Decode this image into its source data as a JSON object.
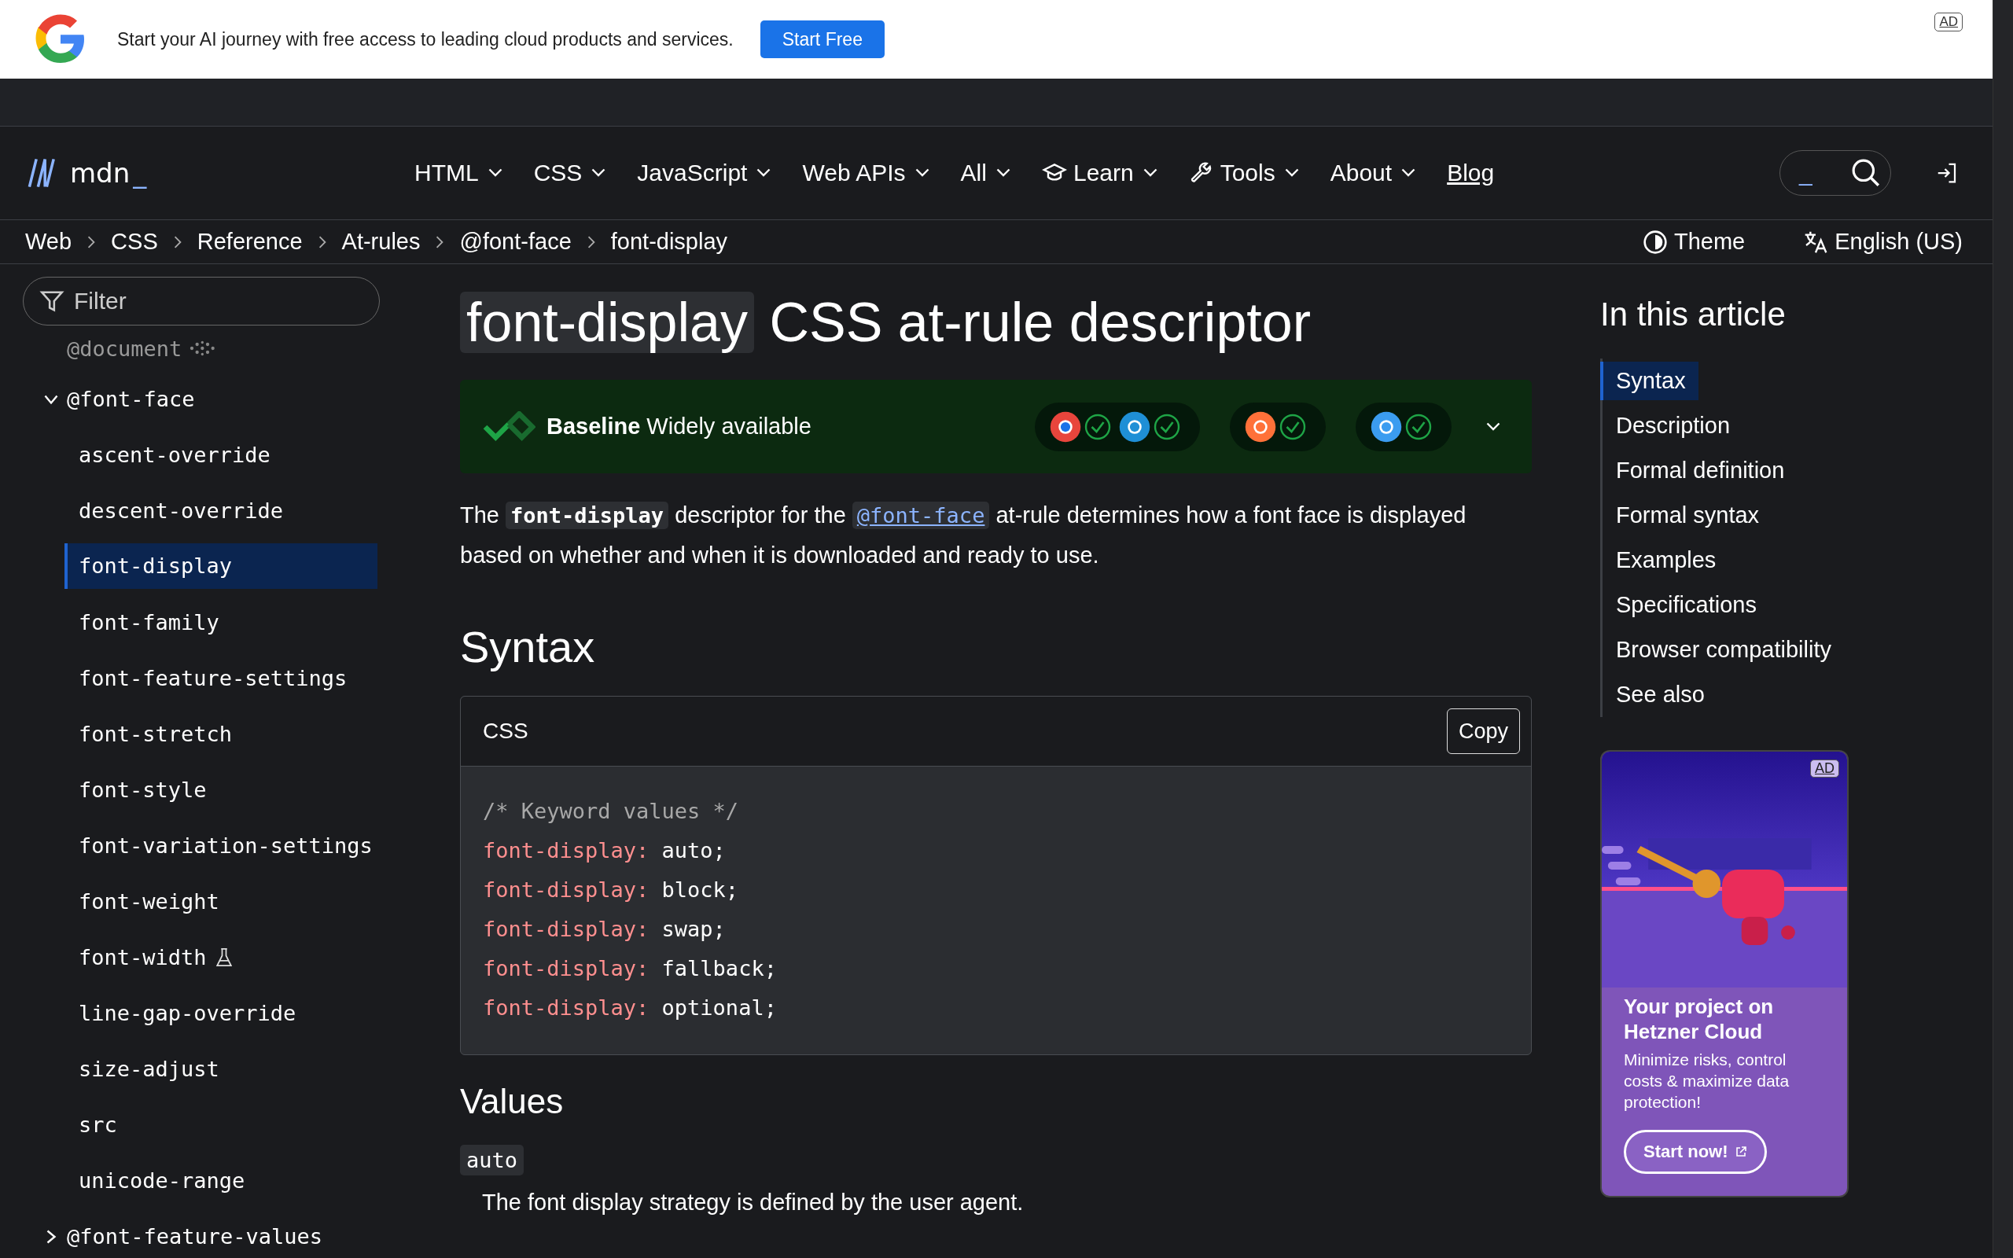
{
  "ad_banner": {
    "text": "Start your AI journey with free access to leading cloud products and services.",
    "button": "Start Free",
    "badge": "AD"
  },
  "nav": {
    "logo_text": "mdn",
    "logo_cursor": "_",
    "items": [
      {
        "label": "HTML",
        "kind": "menu"
      },
      {
        "label": "CSS",
        "kind": "menu"
      },
      {
        "label": "JavaScript",
        "kind": "menu"
      },
      {
        "label": "Web APIs",
        "kind": "menu"
      },
      {
        "label": "All",
        "kind": "menu"
      },
      {
        "label": "Learn",
        "kind": "menu"
      },
      {
        "label": "Tools",
        "kind": "menu"
      },
      {
        "label": "About",
        "kind": "menu"
      },
      {
        "label": "Blog",
        "kind": "link"
      }
    ],
    "search": {
      "value": "_"
    }
  },
  "breadcrumbs": [
    "Web",
    "CSS",
    "Reference",
    "At-rules",
    "@font-face",
    "font-display"
  ],
  "theme_button": "Theme",
  "language_button": "English (US)",
  "sidebar": {
    "filter": {
      "placeholder": "Filter"
    },
    "items": [
      {
        "label": "@document",
        "kind": "deprecated"
      },
      {
        "label": "@font-face",
        "kind": "group",
        "expanded": true,
        "children": [
          {
            "label": "ascent-override",
            "kind": "page",
            "selected": false
          },
          {
            "label": "descent-override",
            "kind": "page",
            "selected": false
          },
          {
            "label": "font-display",
            "kind": "page",
            "selected": true
          },
          {
            "label": "font-family",
            "kind": "page",
            "selected": false
          },
          {
            "label": "font-feature-settings",
            "kind": "page",
            "selected": false
          },
          {
            "label": "font-stretch",
            "kind": "page",
            "selected": false
          },
          {
            "label": "font-style",
            "kind": "page",
            "selected": false
          },
          {
            "label": "font-variation-settings",
            "kind": "page",
            "selected": false
          },
          {
            "label": "font-weight",
            "kind": "page",
            "selected": false
          },
          {
            "label": "font-width",
            "kind": "experimental",
            "selected": false
          },
          {
            "label": "line-gap-override",
            "kind": "page",
            "selected": false
          },
          {
            "label": "size-adjust",
            "kind": "page",
            "selected": false
          },
          {
            "label": "src",
            "kind": "page",
            "selected": false
          },
          {
            "label": "unicode-range",
            "kind": "page",
            "selected": false
          }
        ]
      },
      {
        "label": "@font-feature-values",
        "kind": "group",
        "expanded": false
      }
    ]
  },
  "article": {
    "title_code": "font-display",
    "title_rest": "CSS at-rule descriptor",
    "baseline": {
      "label": "Baseline",
      "status": "Widely available",
      "support_groups": [
        {
          "browsers": [
            {
              "supported": true
            },
            {
              "supported": true
            }
          ]
        },
        {
          "browsers": [
            {
              "supported": true
            }
          ]
        },
        {
          "browsers": [
            {
              "supported": true
            }
          ]
        }
      ]
    },
    "intro": [
      {
        "kind": "text",
        "text": "The "
      },
      {
        "kind": "code",
        "text": "font-display"
      },
      {
        "kind": "text",
        "text": " descriptor for the "
      },
      {
        "kind": "link",
        "text": "@font-face"
      },
      {
        "kind": "text",
        "text": " at-rule determines how a font face is displayed based on whether and when it is downloaded and ready to use."
      }
    ],
    "syntax_heading": "Syntax",
    "code_block": {
      "language": "CSS",
      "copy_button": "Copy",
      "lines": [
        {
          "kind": "comment",
          "text": "/* Keyword values */"
        },
        {
          "kind": "declaration",
          "property": "font-display:",
          "value": "auto;"
        },
        {
          "kind": "declaration",
          "property": "font-display:",
          "value": "block;"
        },
        {
          "kind": "declaration",
          "property": "font-display:",
          "value": "swap;"
        },
        {
          "kind": "declaration",
          "property": "font-display:",
          "value": "fallback;"
        },
        {
          "kind": "declaration",
          "property": "font-display:",
          "value": "optional;"
        }
      ]
    },
    "values_heading": "Values",
    "values": [
      {
        "term": "auto",
        "description": "The font display strategy is defined by the user agent."
      }
    ]
  },
  "toc": {
    "heading": "In this article",
    "items": [
      {
        "label": "Syntax",
        "selected": true
      },
      {
        "label": "Description",
        "selected": false
      },
      {
        "label": "Formal definition",
        "selected": false
      },
      {
        "label": "Formal syntax",
        "selected": false
      },
      {
        "label": "Examples",
        "selected": false
      },
      {
        "label": "Specifications",
        "selected": false
      },
      {
        "label": "Browser compatibility",
        "selected": false
      },
      {
        "label": "See also",
        "selected": false
      }
    ]
  },
  "side_ad": {
    "kind": "picture",
    "badge": "AD",
    "headline": "Your project on Hetzner Cloud",
    "body": "Minimize risks, control costs & maximize data protection!",
    "button": "Start now!"
  }
}
